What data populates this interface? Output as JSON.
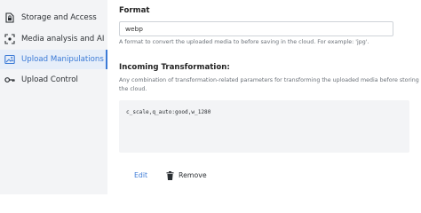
{
  "sidebar": {
    "items": [
      {
        "label": "Storage and Access",
        "icon": "storage-lock-icon",
        "active": false
      },
      {
        "label": "Media analysis and AI",
        "icon": "ai-scan-icon",
        "active": false
      },
      {
        "label": "Upload Manipulations",
        "icon": "image-manipulation-icon",
        "active": true
      },
      {
        "label": "Upload Control",
        "icon": "key-icon",
        "active": false
      }
    ]
  },
  "format": {
    "title": "Format",
    "value": "webp",
    "help": "A format to convert the uploaded media to before saving in the cloud. For example: 'jpg'."
  },
  "incoming": {
    "title": "Incoming Transformation:",
    "help_line1": "Any combination of transformation-related parameters for transforming the uploaded media before storing in",
    "help_line2": "the cloud.",
    "code": "c_scale,q_auto:good,w_1280",
    "edit_label": "Edit",
    "remove_label": "Remove"
  },
  "colors": {
    "accent": "#3b7ad6",
    "sidebar_bg": "#f3f4f6",
    "active_bg": "#e6eef9"
  }
}
